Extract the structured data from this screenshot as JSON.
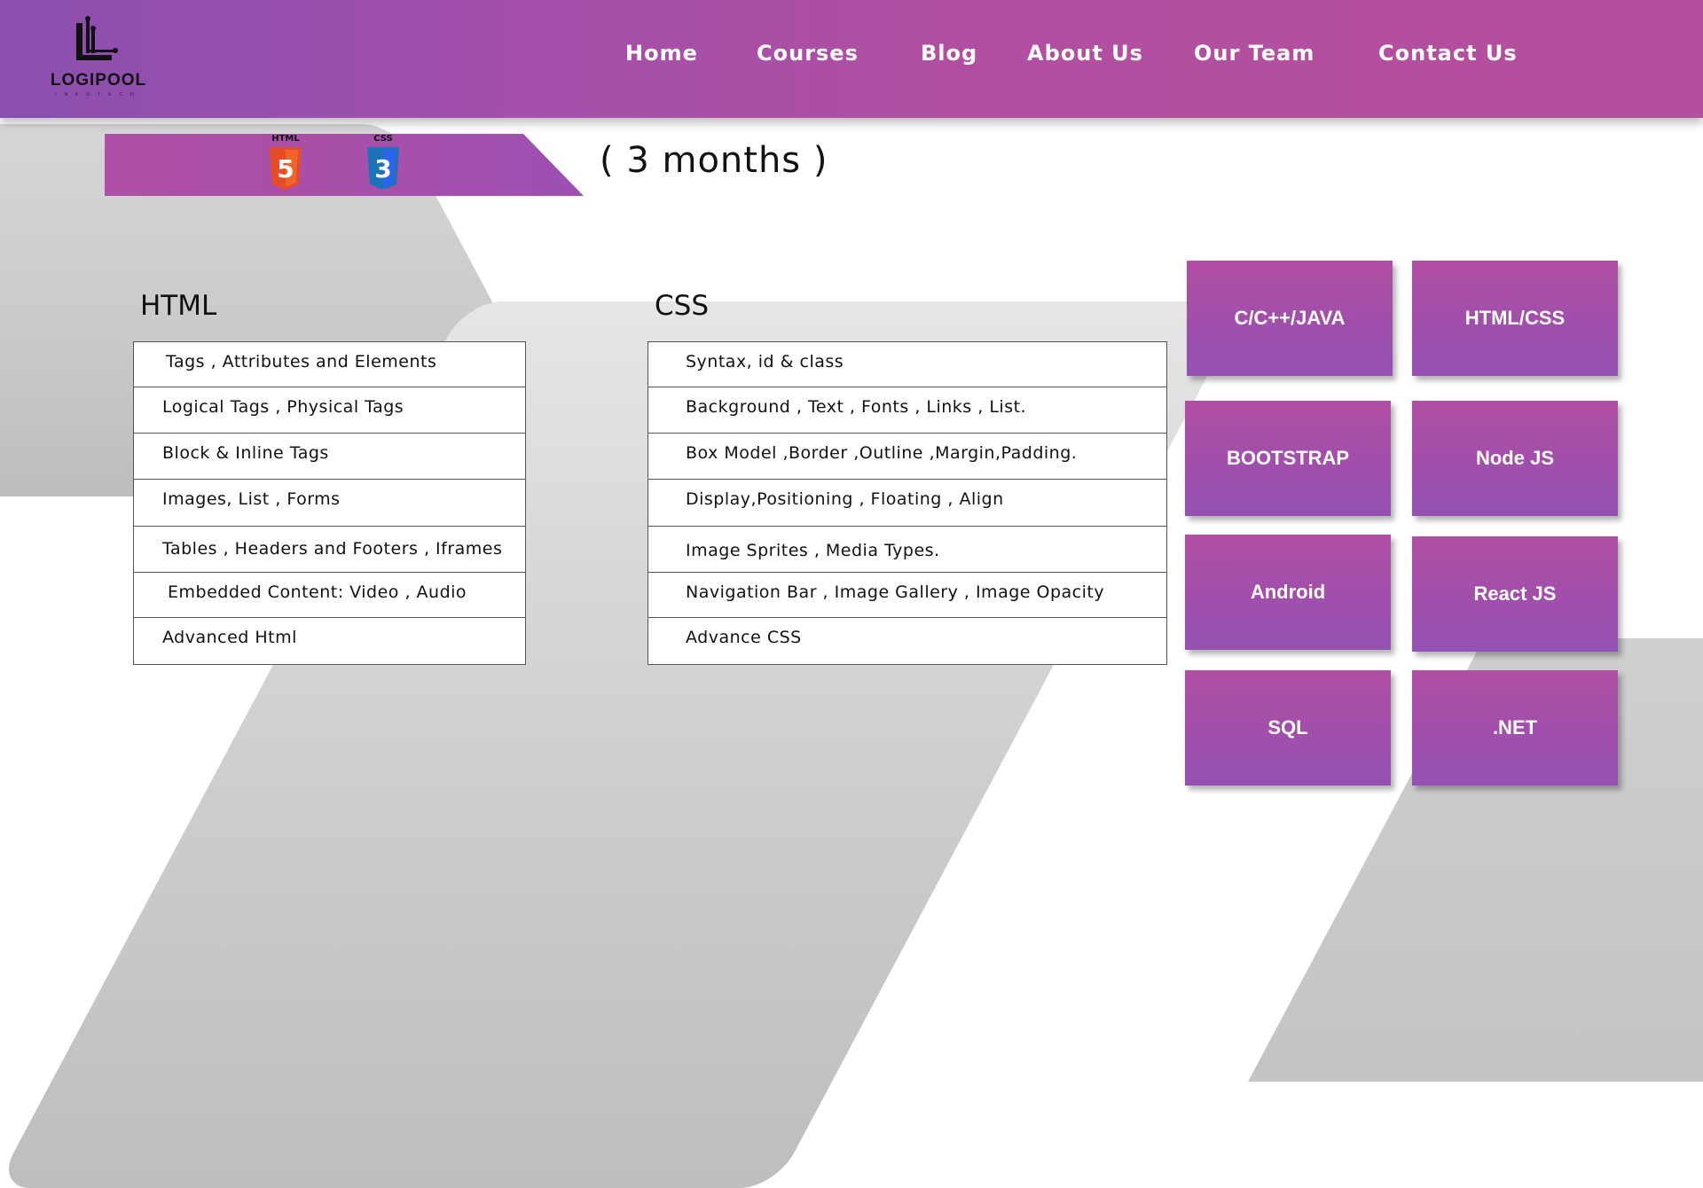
{
  "brand": {
    "name": "LOGIPOOL",
    "tagline": "INFOTECH"
  },
  "nav": [
    {
      "label": "Home"
    },
    {
      "label": "Courses"
    },
    {
      "label": "Blog"
    },
    {
      "label": "About Us"
    },
    {
      "label": "Our Team"
    },
    {
      "label": "Contact Us"
    }
  ],
  "banner": {
    "icons": [
      {
        "label": "HTML",
        "glyph": "5",
        "icon": "html5-icon",
        "color": "#e44d26"
      },
      {
        "label": "CSS",
        "glyph": "3",
        "icon": "css3-icon",
        "color": "#2965f1"
      }
    ],
    "duration": "( 3 months )"
  },
  "html_section": {
    "title": "HTML",
    "topics": [
      "Tags , Attributes and Elements",
      "Logical Tags , Physical Tags",
      "Block & Inline Tags",
      "Images, List , Forms",
      "Tables , Headers and Footers , Iframes",
      "Embedded Content: Video , Audio",
      "Advanced Html"
    ]
  },
  "css_section": {
    "title": "CSS",
    "topics": [
      "Syntax, id & class",
      "Background , Text , Fonts , Links , List.",
      "Box Model ,Border ,Outline ,Margin,Padding.",
      "Display,Positioning , Floating , Align",
      "Image Sprites , Media Types.",
      "Navigation Bar , Image Gallery , Image Opacity",
      "Advance CSS"
    ]
  },
  "courses": [
    "C/C++/JAVA",
    "HTML/CSS",
    "BOOTSTRAP",
    "Node JS",
    "Android",
    "React JS",
    "SQL",
    ".NET"
  ],
  "colors": {
    "header_start": "#8a4fb0",
    "header_end": "#b44f9d",
    "tile": "#a24fab"
  }
}
